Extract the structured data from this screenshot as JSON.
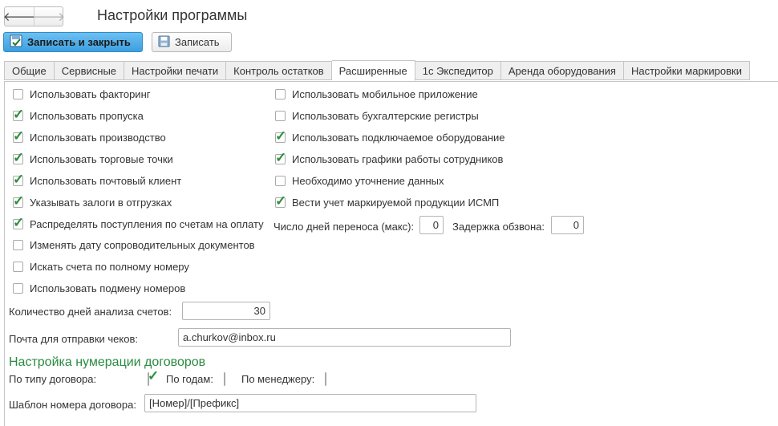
{
  "window": {
    "title": "Настройки программы"
  },
  "nav": {
    "back_glyph": "🡐",
    "forward_glyph": "🡒"
  },
  "toolbar": {
    "save_close_label": "Записать и закрыть",
    "save_label": "Записать"
  },
  "tabs": [
    {
      "label": "Общие"
    },
    {
      "label": "Сервисные"
    },
    {
      "label": "Настройки печати"
    },
    {
      "label": "Контроль остатков"
    },
    {
      "label": "Расширенные",
      "active": true
    },
    {
      "label": "1с Экспедитор"
    },
    {
      "label": "Аренда оборудования"
    },
    {
      "label": "Настройки маркировки"
    }
  ],
  "left_options": [
    {
      "label": "Использовать факторинг",
      "checked": false
    },
    {
      "label": "Использовать пропуска",
      "checked": true
    },
    {
      "label": "Использовать производство",
      "checked": true
    },
    {
      "label": "Использовать торговые точки",
      "checked": true
    },
    {
      "label": "Использовать почтовый клиент",
      "checked": true
    },
    {
      "label": "Указывать залоги в отгрузках",
      "checked": true
    },
    {
      "label": "Распределять поступления по счетам на оплату",
      "checked": true
    },
    {
      "label": "Изменять дату сопроводительных документов",
      "checked": false
    },
    {
      "label": "Искать счета по полному номеру",
      "checked": false
    },
    {
      "label": "Использовать подмену номеров",
      "checked": false
    }
  ],
  "right_options": [
    {
      "label": "Использовать мобильное приложение",
      "checked": false
    },
    {
      "label": "Использовать бухгалтерские регистры",
      "checked": false
    },
    {
      "label": "Использовать подключаемое оборудование",
      "checked": true
    },
    {
      "label": "Использовать графики работы сотрудников",
      "checked": true
    },
    {
      "label": "Необходимо уточнение данных",
      "checked": false
    },
    {
      "label": "Вести учет маркируемой продукции ИСМП",
      "checked": true
    }
  ],
  "transfer_days": {
    "label": "Число дней переноса (макс):",
    "value": "0"
  },
  "call_delay": {
    "label": "Задержка обзвона:",
    "value": "0"
  },
  "analysis_days": {
    "label": "Количество дней анализа счетов:",
    "value": "30"
  },
  "email": {
    "label": "Почта для отправки чеков:",
    "value": "a.churkov@inbox.ru"
  },
  "numbering": {
    "title": "Настройка нумерации договоров",
    "by_type_label": "По типу договора:",
    "by_type_checked": true,
    "by_year_label": "По годам:",
    "by_year_checked": false,
    "by_manager_label": "По менеджеру:",
    "by_manager_checked": false
  },
  "template": {
    "label": "Шаблон номера договора:",
    "value": "[Номер]/[Префикс]"
  },
  "colors": {
    "accent_green": "#2a8a41",
    "primary_button": "#3d9fdf",
    "tick": "#2d8f3c"
  }
}
